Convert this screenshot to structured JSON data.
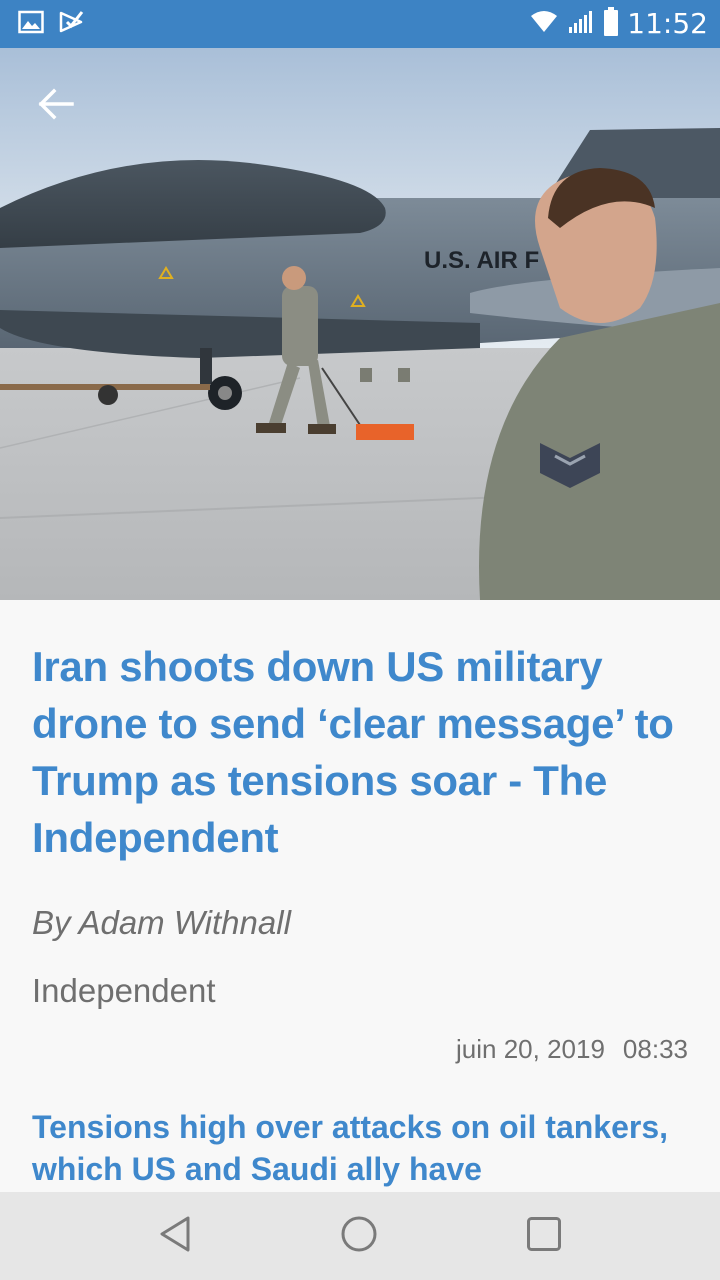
{
  "status_bar": {
    "time": "11:52",
    "icons": [
      "gallery-icon",
      "check-mail-icon",
      "wifi-icon",
      "signal-icon",
      "battery-icon"
    ]
  },
  "hero": {
    "back_icon": "arrow-left-icon",
    "fuselage_text": "U.S. AIR F"
  },
  "article": {
    "headline": "Iran shoots down US military drone to send ‘clear message’ to Trump as tensions soar - The Independent",
    "byline": "By Adam Withnall",
    "source": "Independent",
    "date": "juin 20, 2019",
    "time": "08:33",
    "subheadline": "Tensions high over attacks on oil tankers, which US and Saudi ally have"
  },
  "nav_bar": {
    "buttons": [
      "back-triangle-icon",
      "home-circle-icon",
      "recents-square-icon"
    ]
  },
  "colors": {
    "status_bar": "#3d83c4",
    "headline": "#3f88cc",
    "meta_text": "#6f6f6f",
    "background": "#f8f8f8",
    "nav_bar": "#e6e6e6"
  }
}
